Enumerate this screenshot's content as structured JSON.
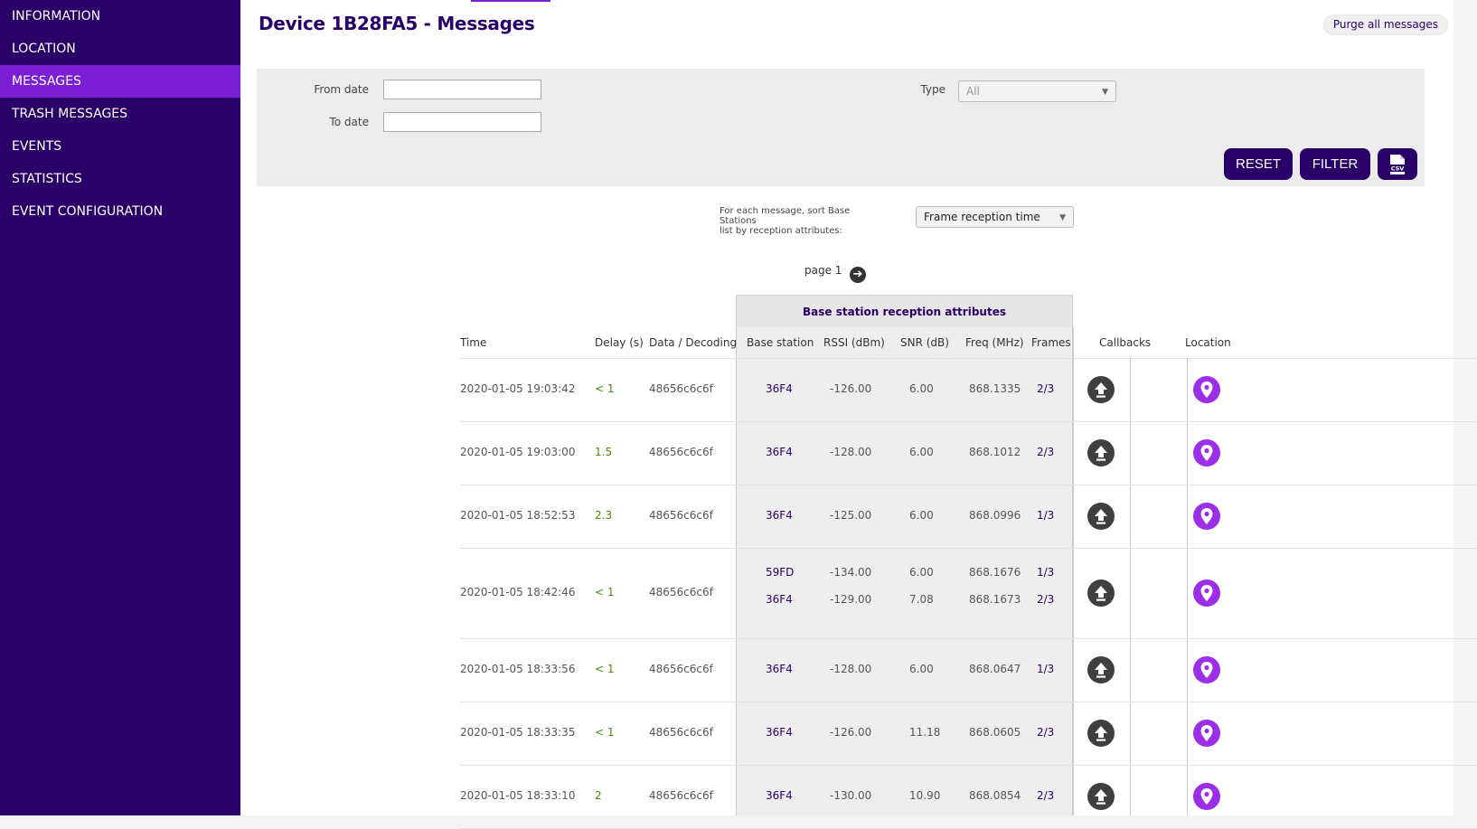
{
  "sidebar": {
    "items": [
      {
        "label": "INFORMATION"
      },
      {
        "label": "LOCATION"
      },
      {
        "label": "MESSAGES"
      },
      {
        "label": "TRASH MESSAGES"
      },
      {
        "label": "EVENTS"
      },
      {
        "label": "STATISTICS"
      },
      {
        "label": "EVENT CONFIGURATION"
      }
    ],
    "active": "MESSAGES"
  },
  "header": {
    "title": "Device 1B28FA5 - Messages",
    "purge_label": "Purge all messages"
  },
  "filters": {
    "from_label": "From date",
    "to_label": "To date",
    "from_value": "",
    "to_value": "",
    "type_label": "Type",
    "type_value": "All",
    "reset_label": "RESET",
    "filter_label": "FILTER",
    "csv_icon": "csv-export-icon"
  },
  "sort": {
    "label_line1": "For each message, sort Base Stations",
    "label_line2": "list by reception attributes:",
    "value": "Frame reception time"
  },
  "pager": {
    "label": "page 1"
  },
  "table": {
    "group_header": "Base station reception attributes",
    "columns": {
      "time": "Time",
      "delay": "Delay (s)",
      "data": "Data / Decoding",
      "base_station": "Base station",
      "rssi": "RSSI (dBm)",
      "snr": "SNR (dB)",
      "freq": "Freq (MHz)",
      "frames": "Frames",
      "callbacks": "Callbacks",
      "location": "Location"
    },
    "rows": [
      {
        "time": "2020-01-05 19:03:42",
        "delay": "< 1",
        "data": "48656c6c6f",
        "stations": [
          {
            "bs": "36F4",
            "rssi": "-126.00",
            "snr": "6.00",
            "freq": "868.1335",
            "frames": "2/3"
          }
        ]
      },
      {
        "time": "2020-01-05 19:03:00",
        "delay": "1.5",
        "data": "48656c6c6f",
        "stations": [
          {
            "bs": "36F4",
            "rssi": "-128.00",
            "snr": "6.00",
            "freq": "868.1012",
            "frames": "2/3"
          }
        ]
      },
      {
        "time": "2020-01-05 18:52:53",
        "delay": "2.3",
        "data": "48656c6c6f",
        "stations": [
          {
            "bs": "36F4",
            "rssi": "-125.00",
            "snr": "6.00",
            "freq": "868.0996",
            "frames": "1/3"
          }
        ]
      },
      {
        "time": "2020-01-05 18:42:46",
        "delay": "< 1",
        "data": "48656c6c6f",
        "stations": [
          {
            "bs": "59FD",
            "rssi": "-134.00",
            "snr": "6.00",
            "freq": "868.1676",
            "frames": "1/3"
          },
          {
            "bs": "36F4",
            "rssi": "-129.00",
            "snr": "7.08",
            "freq": "868.1673",
            "frames": "2/3"
          }
        ]
      },
      {
        "time": "2020-01-05 18:33:56",
        "delay": "< 1",
        "data": "48656c6c6f",
        "stations": [
          {
            "bs": "36F4",
            "rssi": "-128.00",
            "snr": "6.00",
            "freq": "868.0647",
            "frames": "1/3"
          }
        ]
      },
      {
        "time": "2020-01-05 18:33:35",
        "delay": "< 1",
        "data": "48656c6c6f",
        "stations": [
          {
            "bs": "36F4",
            "rssi": "-126.00",
            "snr": "11.18",
            "freq": "868.0605",
            "frames": "2/3"
          }
        ]
      },
      {
        "time": "2020-01-05 18:33:10",
        "delay": "2",
        "data": "48656c6c6f",
        "stations": [
          {
            "bs": "36F4",
            "rssi": "-130.00",
            "snr": "10.90",
            "freq": "868.0854",
            "frames": "2/3"
          }
        ]
      }
    ]
  },
  "colors": {
    "sidebar_bg": "#290067",
    "active_item": "#7a1fd3",
    "location_icon": "#9b2ee6",
    "delay_text": "#4a8a00"
  }
}
